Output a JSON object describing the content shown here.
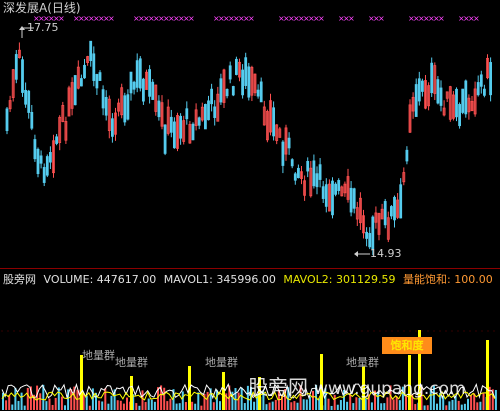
{
  "window": {
    "title": "深发展A(日线)"
  },
  "price_panel": {
    "high_label": "17.75",
    "low_label": "14.93",
    "colors": {
      "up": "#ff5050",
      "down": "#55ccee",
      "signal": "#ff44ff",
      "divider": "#8b0000"
    }
  },
  "indicator": {
    "name": "股旁网",
    "volume_label": "VOLUME: 447617.00",
    "mavol1_label": "MAVOL1: 345996.00",
    "mavol2_label": "MAVOL2: 301129.59",
    "saturation_label": "量能饱和: 100.00",
    "tags": [
      "地量群",
      "地量群",
      "地量群",
      "地量群"
    ],
    "badge": "饱和度",
    "colors": {
      "volume": "#ffff00",
      "mavol1": "#ffffff",
      "mavol2": "#ffff00",
      "saturation": "#ff9933"
    }
  },
  "watermark": {
    "text": "股旁网",
    "url": "www.gupang.com"
  }
}
